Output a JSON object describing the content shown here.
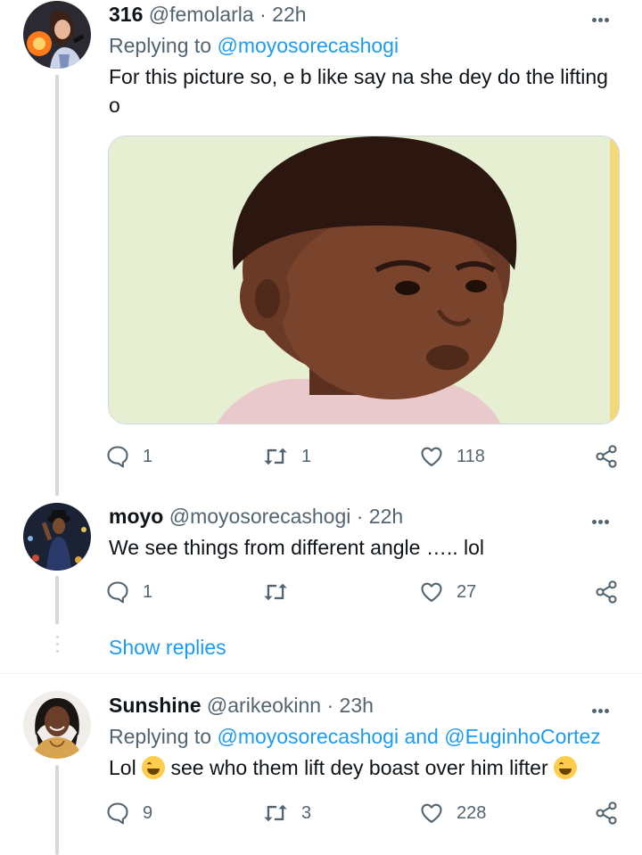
{
  "tweets": [
    {
      "name": "316",
      "handle": "@femolarla",
      "separator": "·",
      "time": "22h",
      "replying_prefix": "Replying to",
      "replying_mentions": [
        "@moyosorecashogi"
      ],
      "text": "For this picture so, e b like say na she dey do the lifting o",
      "media_icon": "photo-child-meme",
      "replies": "1",
      "retweets": "1",
      "likes": "118"
    },
    {
      "name": "moyo",
      "handle": "@moyosorecashogi",
      "separator": "·",
      "time": "22h",
      "text": "We see things from different angle ….. lol",
      "replies": "1",
      "retweets": "",
      "likes": "27"
    },
    {
      "name": "Sunshine",
      "handle": "@arikeokinn",
      "separator": "·",
      "time": "23h",
      "replying_prefix": "Replying to",
      "replying_mentions": [
        "@moyosorecashogi",
        "@EuginhoCortez"
      ],
      "replying_joiner": "and",
      "text_part1": "Lol",
      "text_part2": "see who them lift dey boast over him lifter",
      "emoji_icon": "face-with-tears-of-joy-icon",
      "replies": "9",
      "retweets": "3",
      "likes": "228"
    }
  ],
  "show_replies": "Show replies",
  "colors": {
    "accent": "#1d9bf0",
    "muted": "#536471",
    "thread_line": "#cfd9de"
  },
  "icons": [
    "reply-icon",
    "retweet-icon",
    "like-icon",
    "share-icon",
    "more-icon"
  ]
}
